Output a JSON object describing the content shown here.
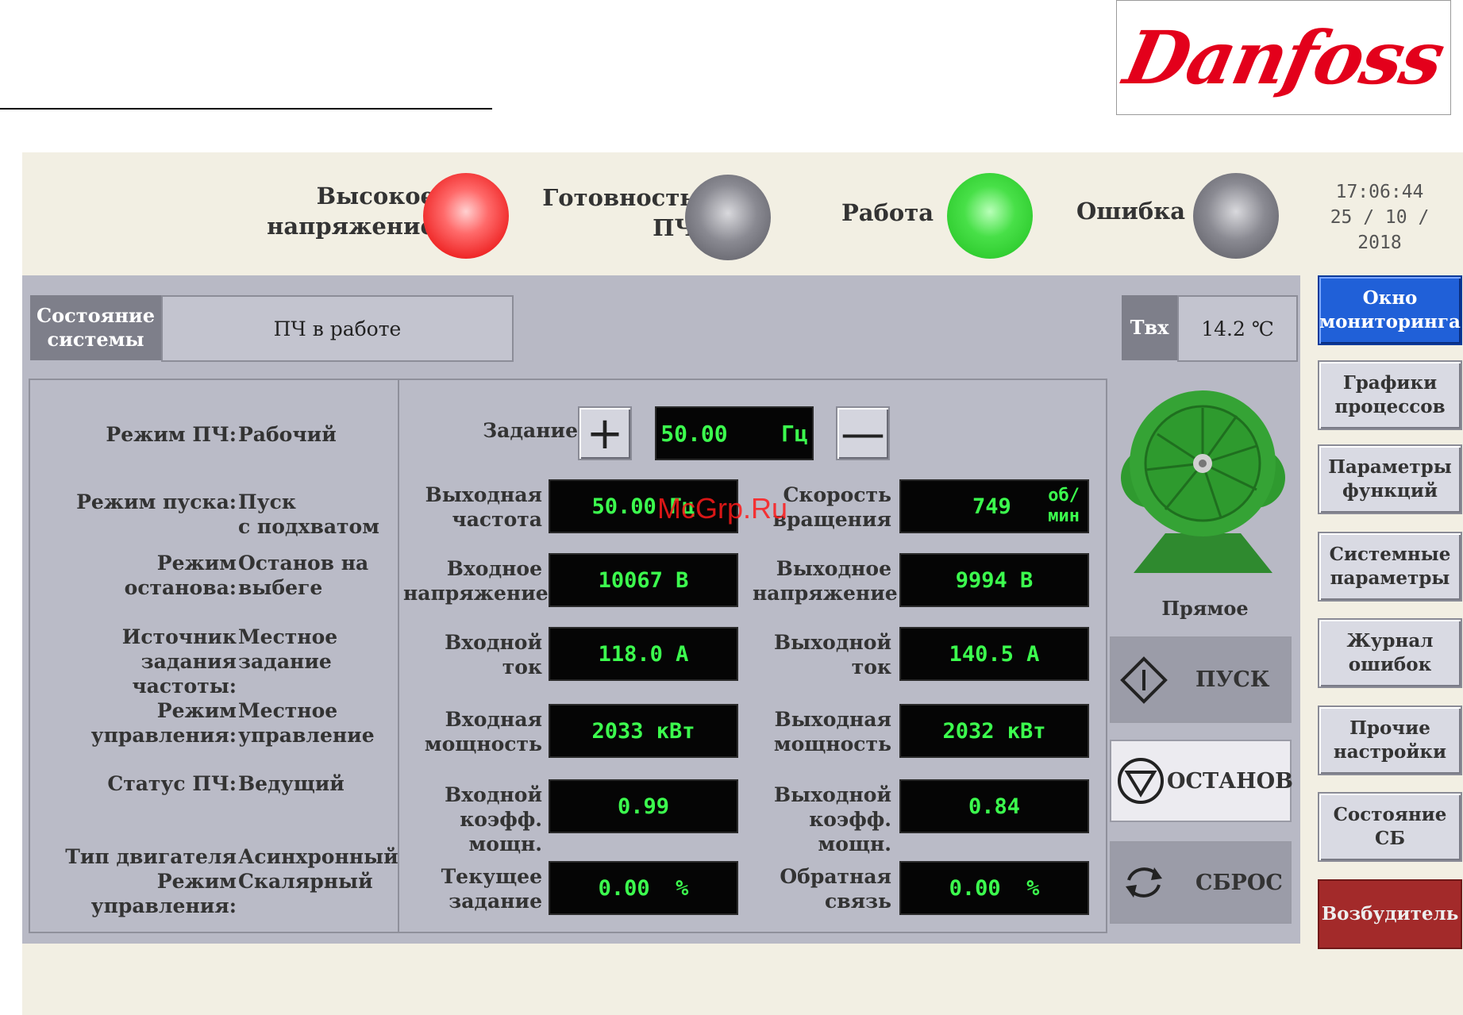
{
  "logo": {
    "text": "Danfoss"
  },
  "indicators": [
    {
      "label_line1": "Высокое",
      "label_line2": "напряжение",
      "state": "on",
      "color": "#ee2424"
    },
    {
      "label_line1": "Готовность",
      "label_line2": "ПЧ",
      "state": "off",
      "color": "#6a6a72"
    },
    {
      "label_line1": "Работа",
      "label_line2": "",
      "state": "on",
      "color": "#1fcf1f"
    },
    {
      "label_line1": "Ошибка",
      "label_line2": "",
      "state": "off",
      "color": "#6a6a72"
    }
  ],
  "clock": {
    "time": "17:06:44",
    "date": "25 / 10 / 2018"
  },
  "system_state": {
    "label_line1": "Состояние",
    "label_line2": "системы",
    "value": "ПЧ в работе"
  },
  "tin": {
    "label": "Твх",
    "value": "14.2 ℃"
  },
  "info": [
    {
      "label_line1": "",
      "label_line2": "Режим ПЧ:",
      "value_line1": "Рабочий",
      "value_line2": ""
    },
    {
      "label_line1": "",
      "label_line2": "Режим пуска:",
      "value_line1": "Пуск",
      "value_line2": "с подхватом"
    },
    {
      "label_line1": "Режим",
      "label_line2": "останова:",
      "value_line1": "Останов на",
      "value_line2": "выбеге"
    },
    {
      "label_line1": "Источник",
      "label_line2": "задания частоты:",
      "value_line1": "Местное",
      "value_line2": "задание"
    },
    {
      "label_line1": "Режим",
      "label_line2": "управления:",
      "value_line1": "Местное",
      "value_line2": "управление"
    },
    {
      "label_line1": "",
      "label_line2": "Статус ПЧ:",
      "value_line1": "Ведущий",
      "value_line2": ""
    },
    {
      "label_line1": "Тип двигателя",
      "label_line2": "Режим управления:",
      "value_line1": "Асинхронный",
      "value_line2": "Скалярный"
    }
  ],
  "setpoint": {
    "label": "Задание",
    "value": "50.00",
    "unit": "Гц",
    "plus": "+",
    "minus": "—"
  },
  "measurements": {
    "left": [
      {
        "label_line1": "Выходная",
        "label_line2": "частота",
        "value": "50.00 Гц"
      },
      {
        "label_line1": "Входное",
        "label_line2": "напряжение",
        "value": "10067 В"
      },
      {
        "label_line1": "Входной",
        "label_line2": "ток",
        "value": "118.0 А"
      },
      {
        "label_line1": "Входная",
        "label_line2": "мощность",
        "value": "2033 кВт"
      },
      {
        "label_line1": "Входной",
        "label_line2": "коэфф. мощн.",
        "value": "0.99"
      },
      {
        "label_line1": "Текущее",
        "label_line2": "задание",
        "value": "0.00  %"
      }
    ],
    "right": [
      {
        "label_line1": "Скорость",
        "label_line2": "вращения",
        "value": "749",
        "unit_line1": "об/",
        "unit_line2": "мин"
      },
      {
        "label_line1": "Выходное",
        "label_line2": "напряжение",
        "value": "9994 В"
      },
      {
        "label_line1": "Выходной",
        "label_line2": "ток",
        "value": "140.5 А"
      },
      {
        "label_line1": "Выходная",
        "label_line2": "мощность",
        "value": "2032 кВт"
      },
      {
        "label_line1": "Выходной",
        "label_line2": "коэфф. мощн.",
        "value": "0.84"
      },
      {
        "label_line1": "Обратная",
        "label_line2": "связь",
        "value": "0.00  %"
      }
    ]
  },
  "motor": {
    "direction": "Прямое"
  },
  "actions": {
    "start": "ПУСК",
    "stop": "ОСТАНОВ",
    "reset": "СБРОС"
  },
  "nav": [
    {
      "line1": "Окно",
      "line2": "мониторинга"
    },
    {
      "line1": "Графики",
      "line2": "процессов"
    },
    {
      "line1": "Параметры",
      "line2": "функций"
    },
    {
      "line1": "Системные",
      "line2": "параметры"
    },
    {
      "line1": "Журнал",
      "line2": "ошибок"
    },
    {
      "line1": "Прочие",
      "line2": "настройки"
    },
    {
      "line1": "Состояние",
      "line2": "СБ"
    },
    {
      "line1": "Возбудитель",
      "line2": ""
    }
  ],
  "watermark": "McGrp.Ru"
}
